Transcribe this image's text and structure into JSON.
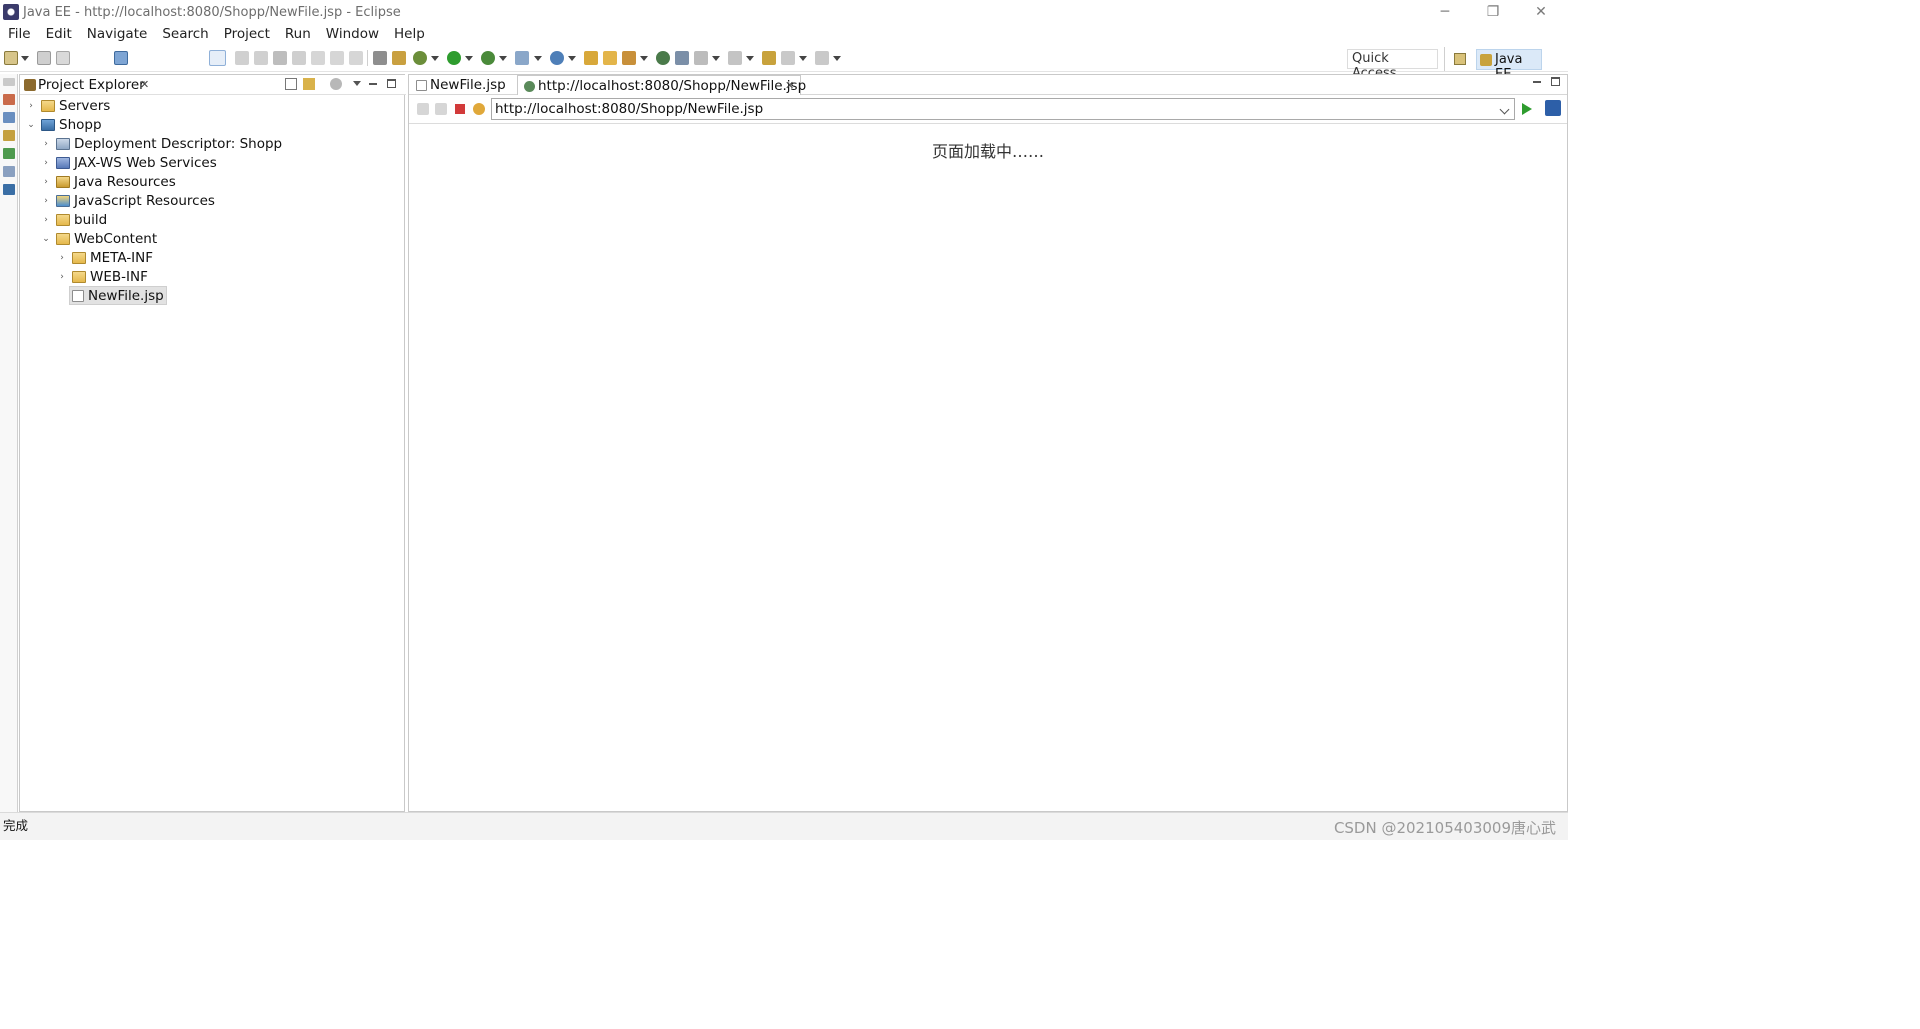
{
  "window": {
    "title": "Java EE - http://localhost:8080/Shopp/NewFile.jsp - Eclipse",
    "minimize": "─",
    "restore": "❐",
    "close": "✕"
  },
  "menu": [
    "File",
    "Edit",
    "Navigate",
    "Search",
    "Project",
    "Run",
    "Window",
    "Help"
  ],
  "toolbar": {
    "quick_access": "Quick Access",
    "perspective": "Java EE"
  },
  "explorer": {
    "title": "Project Explorer",
    "close": "✕",
    "tree": [
      {
        "label": "Servers",
        "expanded": false,
        "icon": "folder-icon"
      },
      {
        "label": "Shopp",
        "expanded": true,
        "icon": "project-icon"
      },
      {
        "label": "Deployment Descriptor: Shopp",
        "expanded": false,
        "icon": "deployment-descriptor-icon"
      },
      {
        "label": "JAX-WS Web Services",
        "expanded": false,
        "icon": "web-services-icon"
      },
      {
        "label": "Java Resources",
        "expanded": false,
        "icon": "java-resources-icon"
      },
      {
        "label": "JavaScript Resources",
        "expanded": false,
        "icon": "javascript-resources-icon"
      },
      {
        "label": "build",
        "expanded": false,
        "icon": "folder-icon"
      },
      {
        "label": "WebContent",
        "expanded": true,
        "icon": "folder-icon"
      },
      {
        "label": "META-INF",
        "expanded": false,
        "icon": "folder-icon"
      },
      {
        "label": "WEB-INF",
        "expanded": false,
        "icon": "folder-icon"
      },
      {
        "label": "NewFile.jsp",
        "selected": true,
        "icon": "jsp-file-icon"
      }
    ]
  },
  "editor": {
    "tabs": [
      {
        "label": "NewFile.jsp",
        "active": false
      },
      {
        "label": "http://localhost:8080/Shopp/NewFile.jsp",
        "active": true,
        "close": "✕"
      }
    ],
    "url": "http://localhost:8080/Shopp/NewFile.jsp",
    "content_text": "页面加载中……"
  },
  "status": {
    "text": "完成",
    "watermark": "CSDN @202105403009唐心武"
  },
  "colors": {
    "selection": "#e2e2e2",
    "perspective_active": "#dbe9f8",
    "go_green": "#2e9c2e"
  }
}
